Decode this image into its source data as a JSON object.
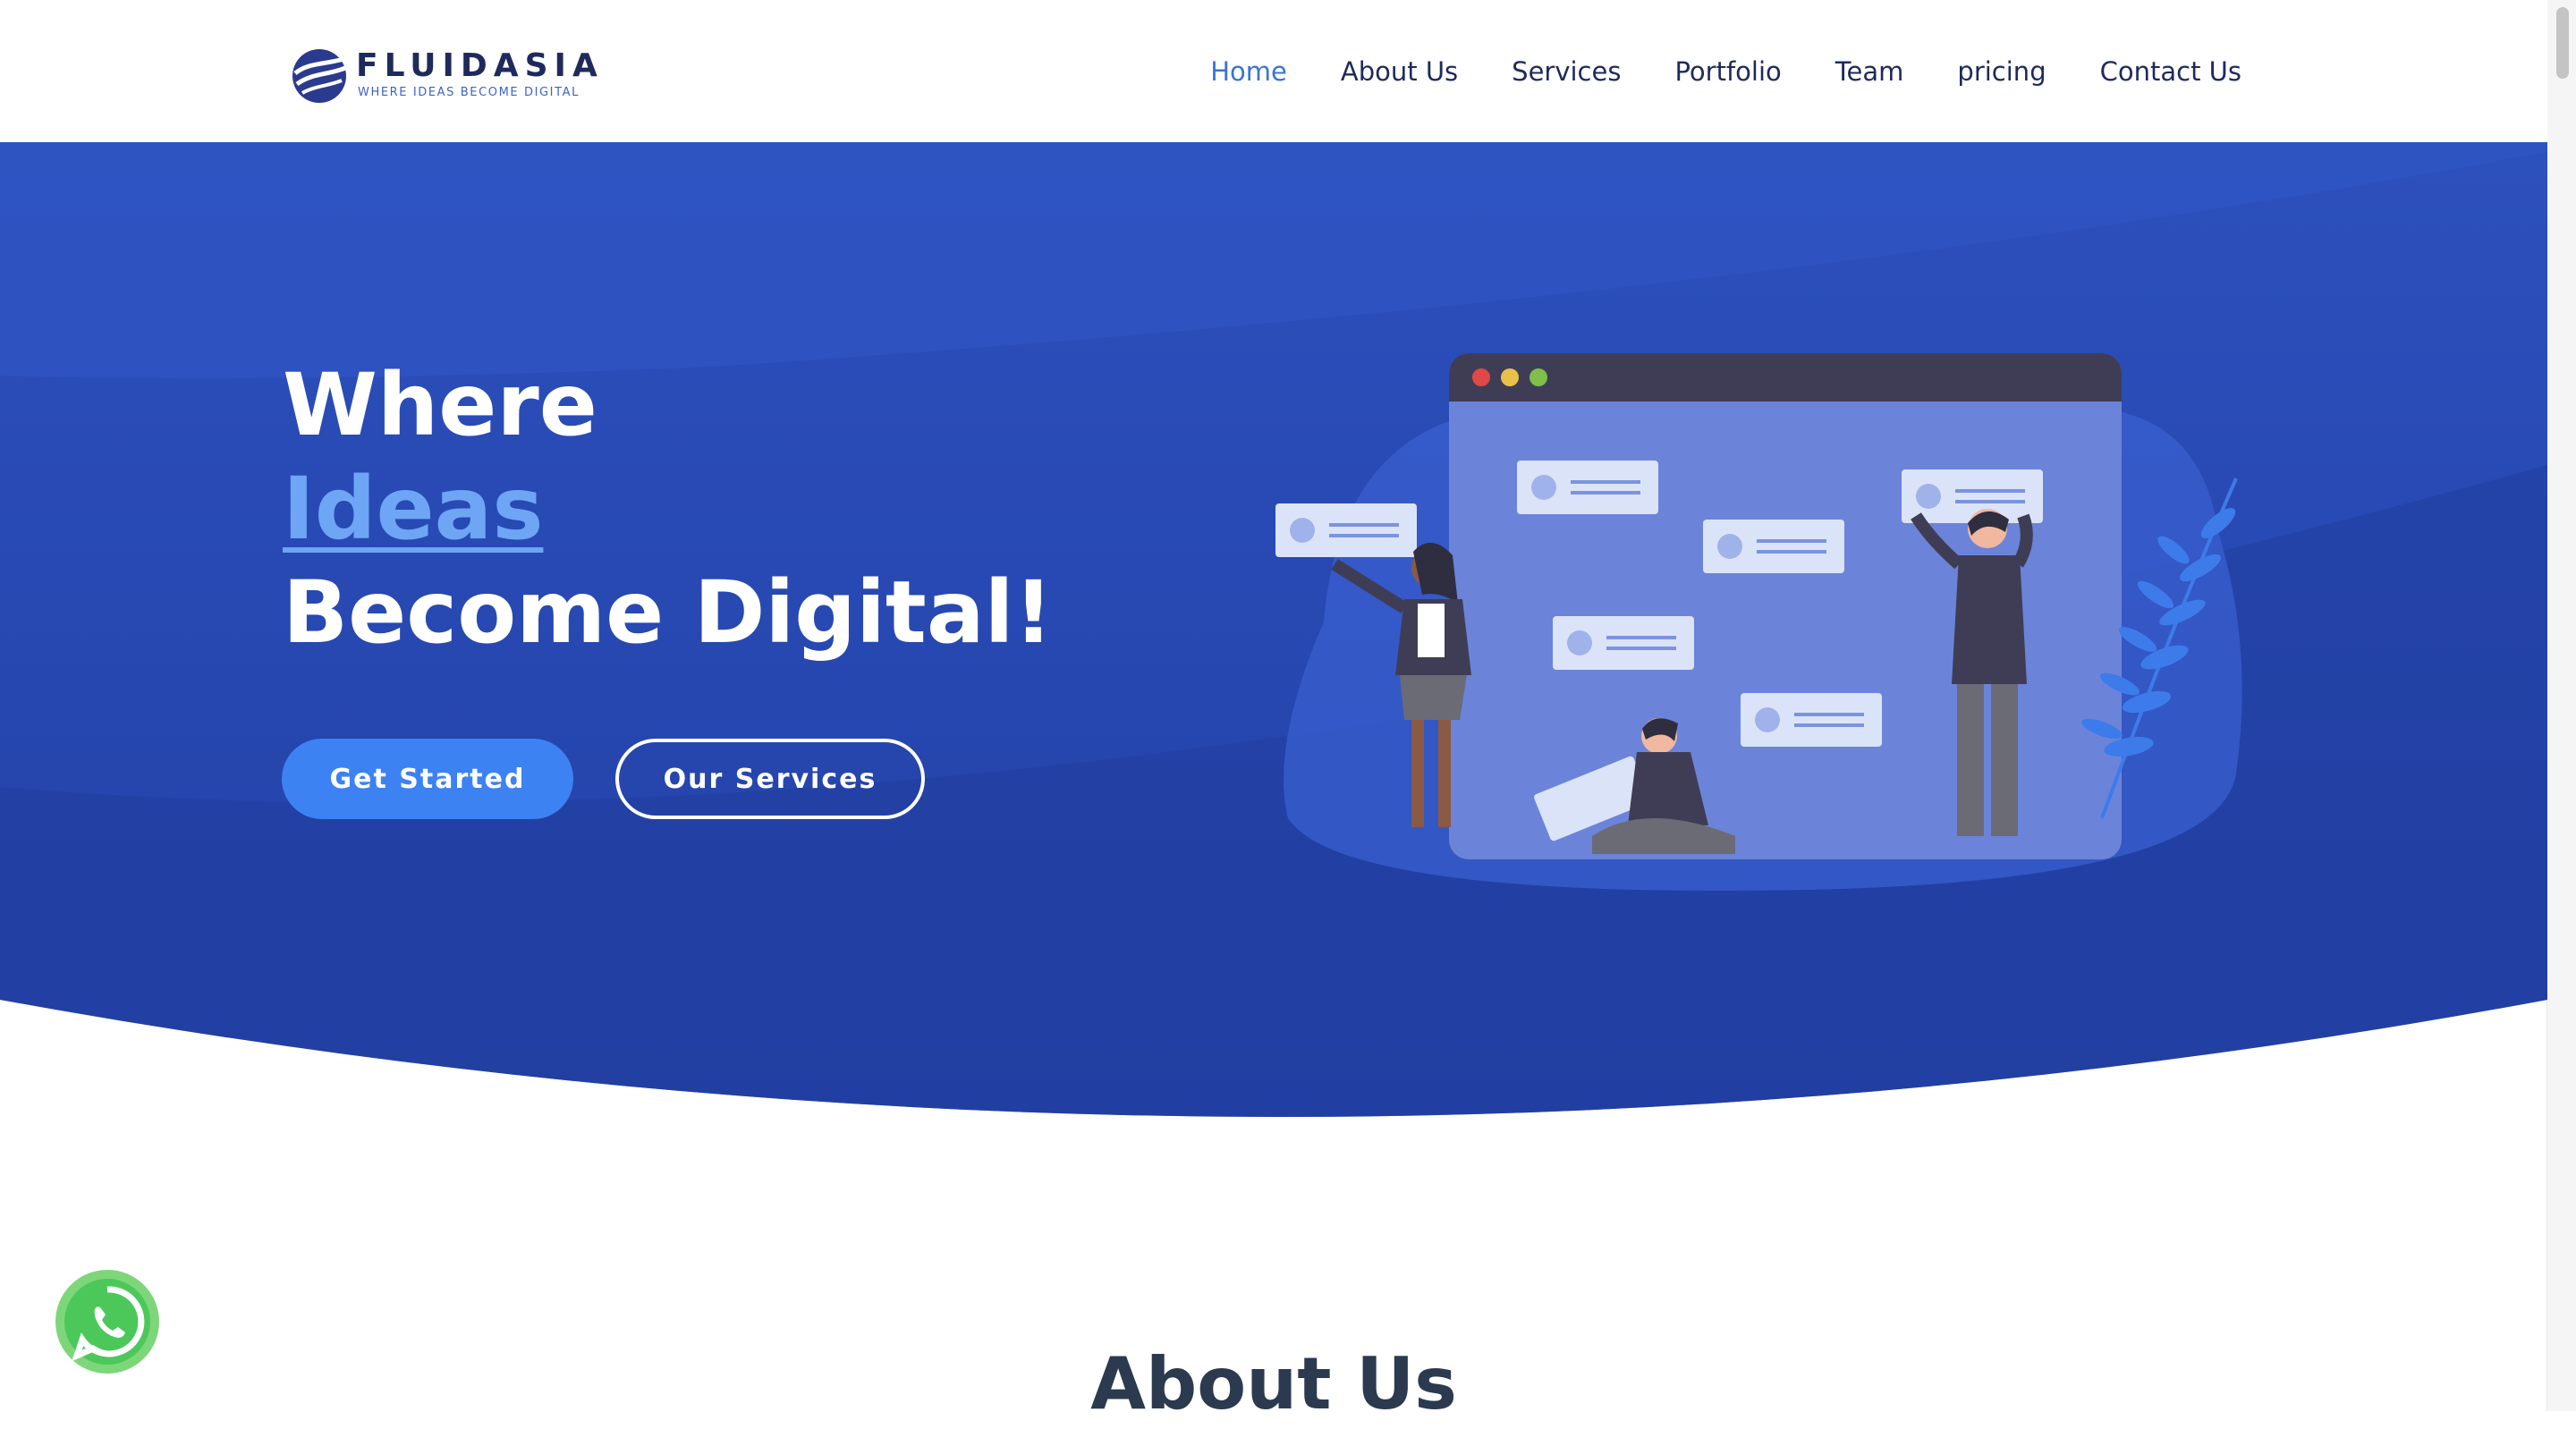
{
  "header": {
    "logo": {
      "name": "FLUIDASIA",
      "tagline": "WHERE IDEAS BECOME DIGITAL"
    },
    "nav": [
      {
        "label": "Home",
        "active": true
      },
      {
        "label": "About Us",
        "active": false
      },
      {
        "label": "Services",
        "active": false
      },
      {
        "label": "Portfolio",
        "active": false
      },
      {
        "label": "Team",
        "active": false
      },
      {
        "label": "pricing",
        "active": false
      },
      {
        "label": "Contact Us",
        "active": false
      }
    ]
  },
  "hero": {
    "line1": "Where",
    "line2": "Ideas",
    "line3": "Become Digital!",
    "primary_button": "Get Started",
    "secondary_button": "Our Services",
    "illustration_icon": "team-collaboration-illustration"
  },
  "about": {
    "title": "About Us"
  },
  "floating": {
    "whatsapp_icon": "whatsapp-icon"
  },
  "colors": {
    "hero_background": "#2747b2",
    "accent": "#6ea5f5",
    "primary_button": "#3d82f2",
    "nav_active": "#3a74d6",
    "nav_text": "#1f2a5c",
    "whatsapp": "#4cc85a"
  }
}
